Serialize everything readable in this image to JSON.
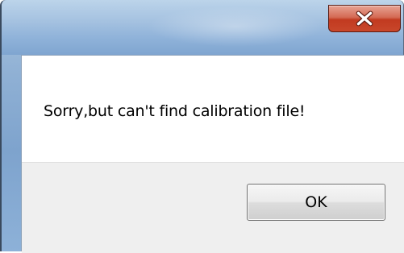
{
  "dialog": {
    "title": "",
    "message": "Sorry,but can't find calibration file!",
    "ok_label": "OK",
    "close_icon": "close-icon"
  },
  "colors": {
    "titlebar": "#a4c1e0",
    "close_button": "#c8472b",
    "client_background": "#ffffff",
    "button_area_background": "#efefef",
    "button_face": "#e6e6e6"
  }
}
